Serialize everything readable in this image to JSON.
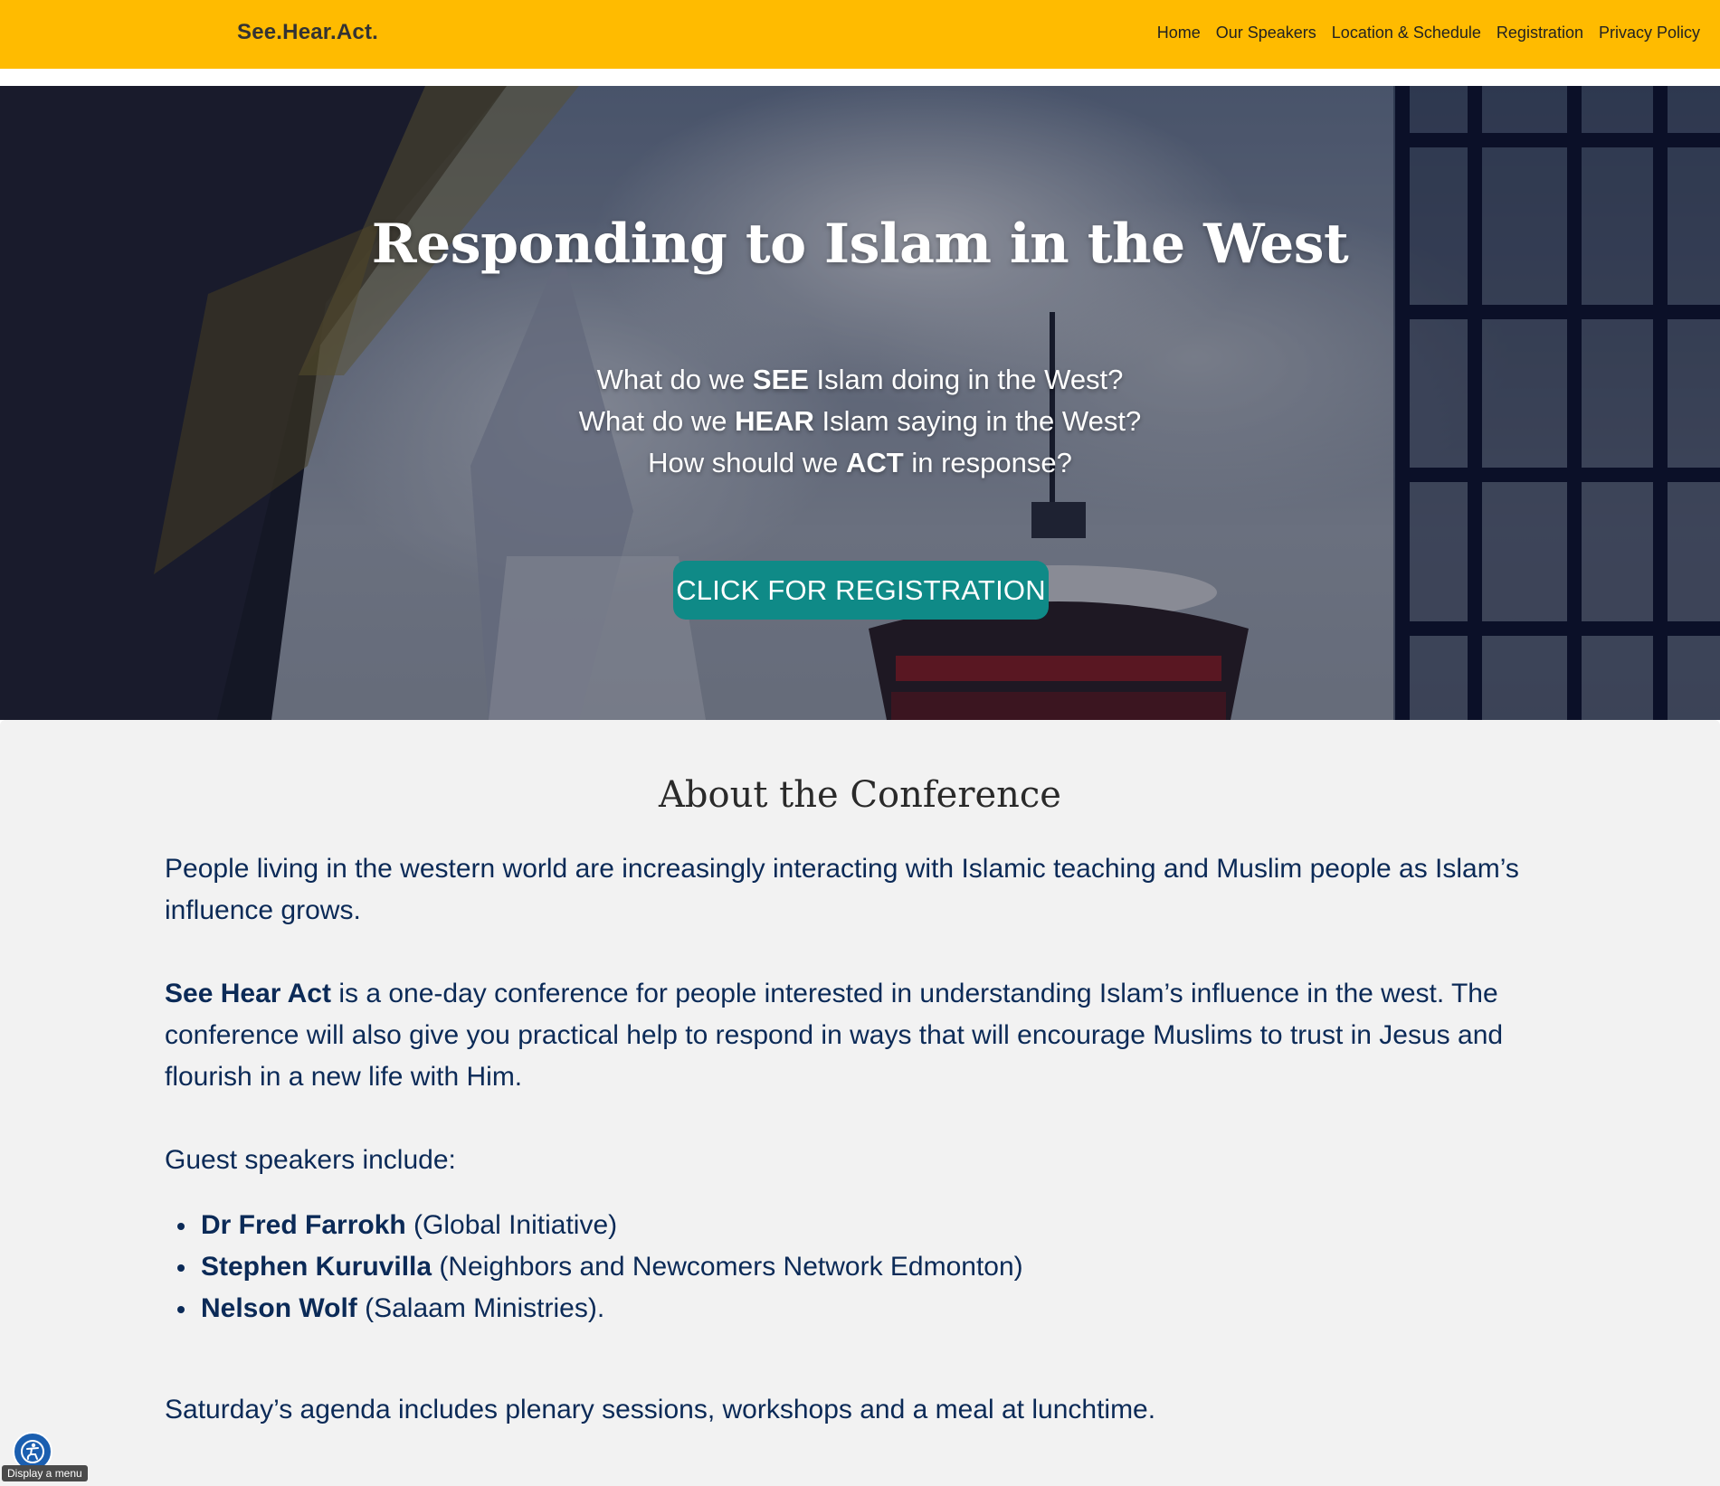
{
  "header": {
    "site_title": "See.Hear.Act.",
    "nav": [
      {
        "label": "Home"
      },
      {
        "label": "Our Speakers"
      },
      {
        "label": "Location & Schedule"
      },
      {
        "label": "Registration"
      },
      {
        "label": "Privacy Policy"
      }
    ],
    "background_color": "#ffbb00"
  },
  "hero": {
    "title": "Responding to Islam in the West",
    "questions": [
      {
        "before": "What do we ",
        "bold": "SEE",
        "after": " Islam doing in the West?"
      },
      {
        "before": "What do we ",
        "bold": "HEAR",
        "after": " Islam saying in the West?"
      },
      {
        "before": "How should we ",
        "bold": "ACT",
        "after": " in response?"
      }
    ],
    "cta_label": "CLICK FOR REGISTRATION",
    "cta_color": "#0f8a87"
  },
  "about": {
    "heading": "About the Conference",
    "paragraph1": "People living in the western world are increasingly interacting with Islamic teaching and Muslim people as Islam’s influence grows.",
    "paragraph2_bold": "See Hear Act",
    "paragraph2_rest": " is a one-day conference for people interested in understanding Islam’s influence in the west. The conference will also give you practical help to respond in ways that will encourage Muslims to trust in Jesus and flourish in a new life with Him.",
    "speakers_intro": "Guest speakers include:",
    "speakers": [
      {
        "name": "Dr Fred Farrokh",
        "org": " (Global Initiative)"
      },
      {
        "name": "Stephen Kuruvilla",
        "org": " (Neighbors and Newcomers Network Edmonton)"
      },
      {
        "name": "Nelson Wolf",
        "org": " (Salaam Ministries)."
      }
    ],
    "agenda": "Saturday’s agenda includes plenary sessions, workshops and a meal at lunchtime.",
    "text_color": "#0b2a57"
  },
  "accessibility": {
    "icon": "accessibility-icon",
    "tooltip": "Display a menu"
  }
}
